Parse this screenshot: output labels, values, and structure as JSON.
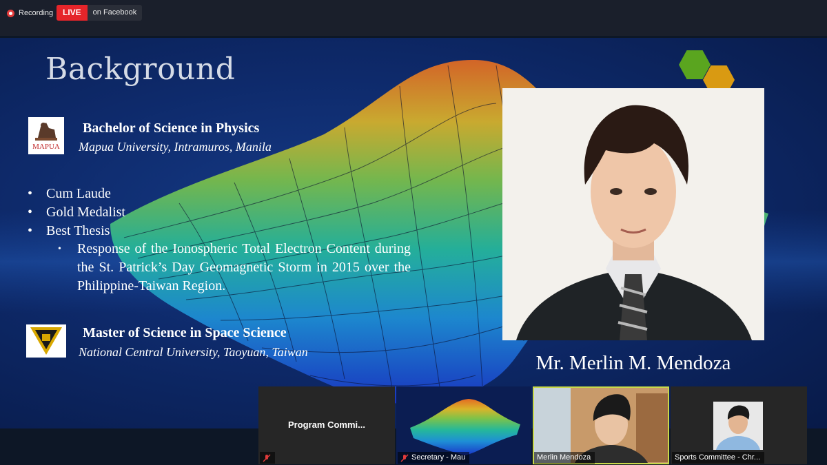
{
  "topbar": {
    "recording_label": "Recording",
    "live_badge": "LIVE",
    "live_destination": "on Facebook"
  },
  "slide": {
    "title": "Background",
    "education": [
      {
        "degree": "Bachelor of Science in Physics",
        "school": "Mapua University, Intramuros, Manila",
        "logo_text": "MAPUA"
      },
      {
        "degree": "Master of Science in Space Science",
        "school": "National Central University, Taoyuan, Taiwan"
      }
    ],
    "honors": [
      "Cum Laude",
      "Gold Medalist",
      "Best Thesis"
    ],
    "thesis": "Response of the Ionospheric Total Electron Content during the St. Patrick’s Day Geomagnetic Storm in 2015 over the Philippine-Taiwan Region.",
    "speaker_name": "Mr. Merlin M. Mendoza",
    "colors": {
      "background": "#0e2a6b",
      "hex_green": "#5aa51f",
      "hex_orange": "#d99a12"
    }
  },
  "participants": [
    {
      "name": "Program Commi...",
      "label": "",
      "muted": true,
      "video": false
    },
    {
      "name": "Secretary - Mau",
      "label": "Secretary - Mau",
      "muted": true,
      "video": true
    },
    {
      "name": "Merlin Mendoza",
      "label": "Merlin Mendoza",
      "muted": false,
      "video": true,
      "active": true
    },
    {
      "name": "Sports Committee - Chr...",
      "label": "Sports Committee - Chr...",
      "muted": false,
      "video": true
    }
  ]
}
